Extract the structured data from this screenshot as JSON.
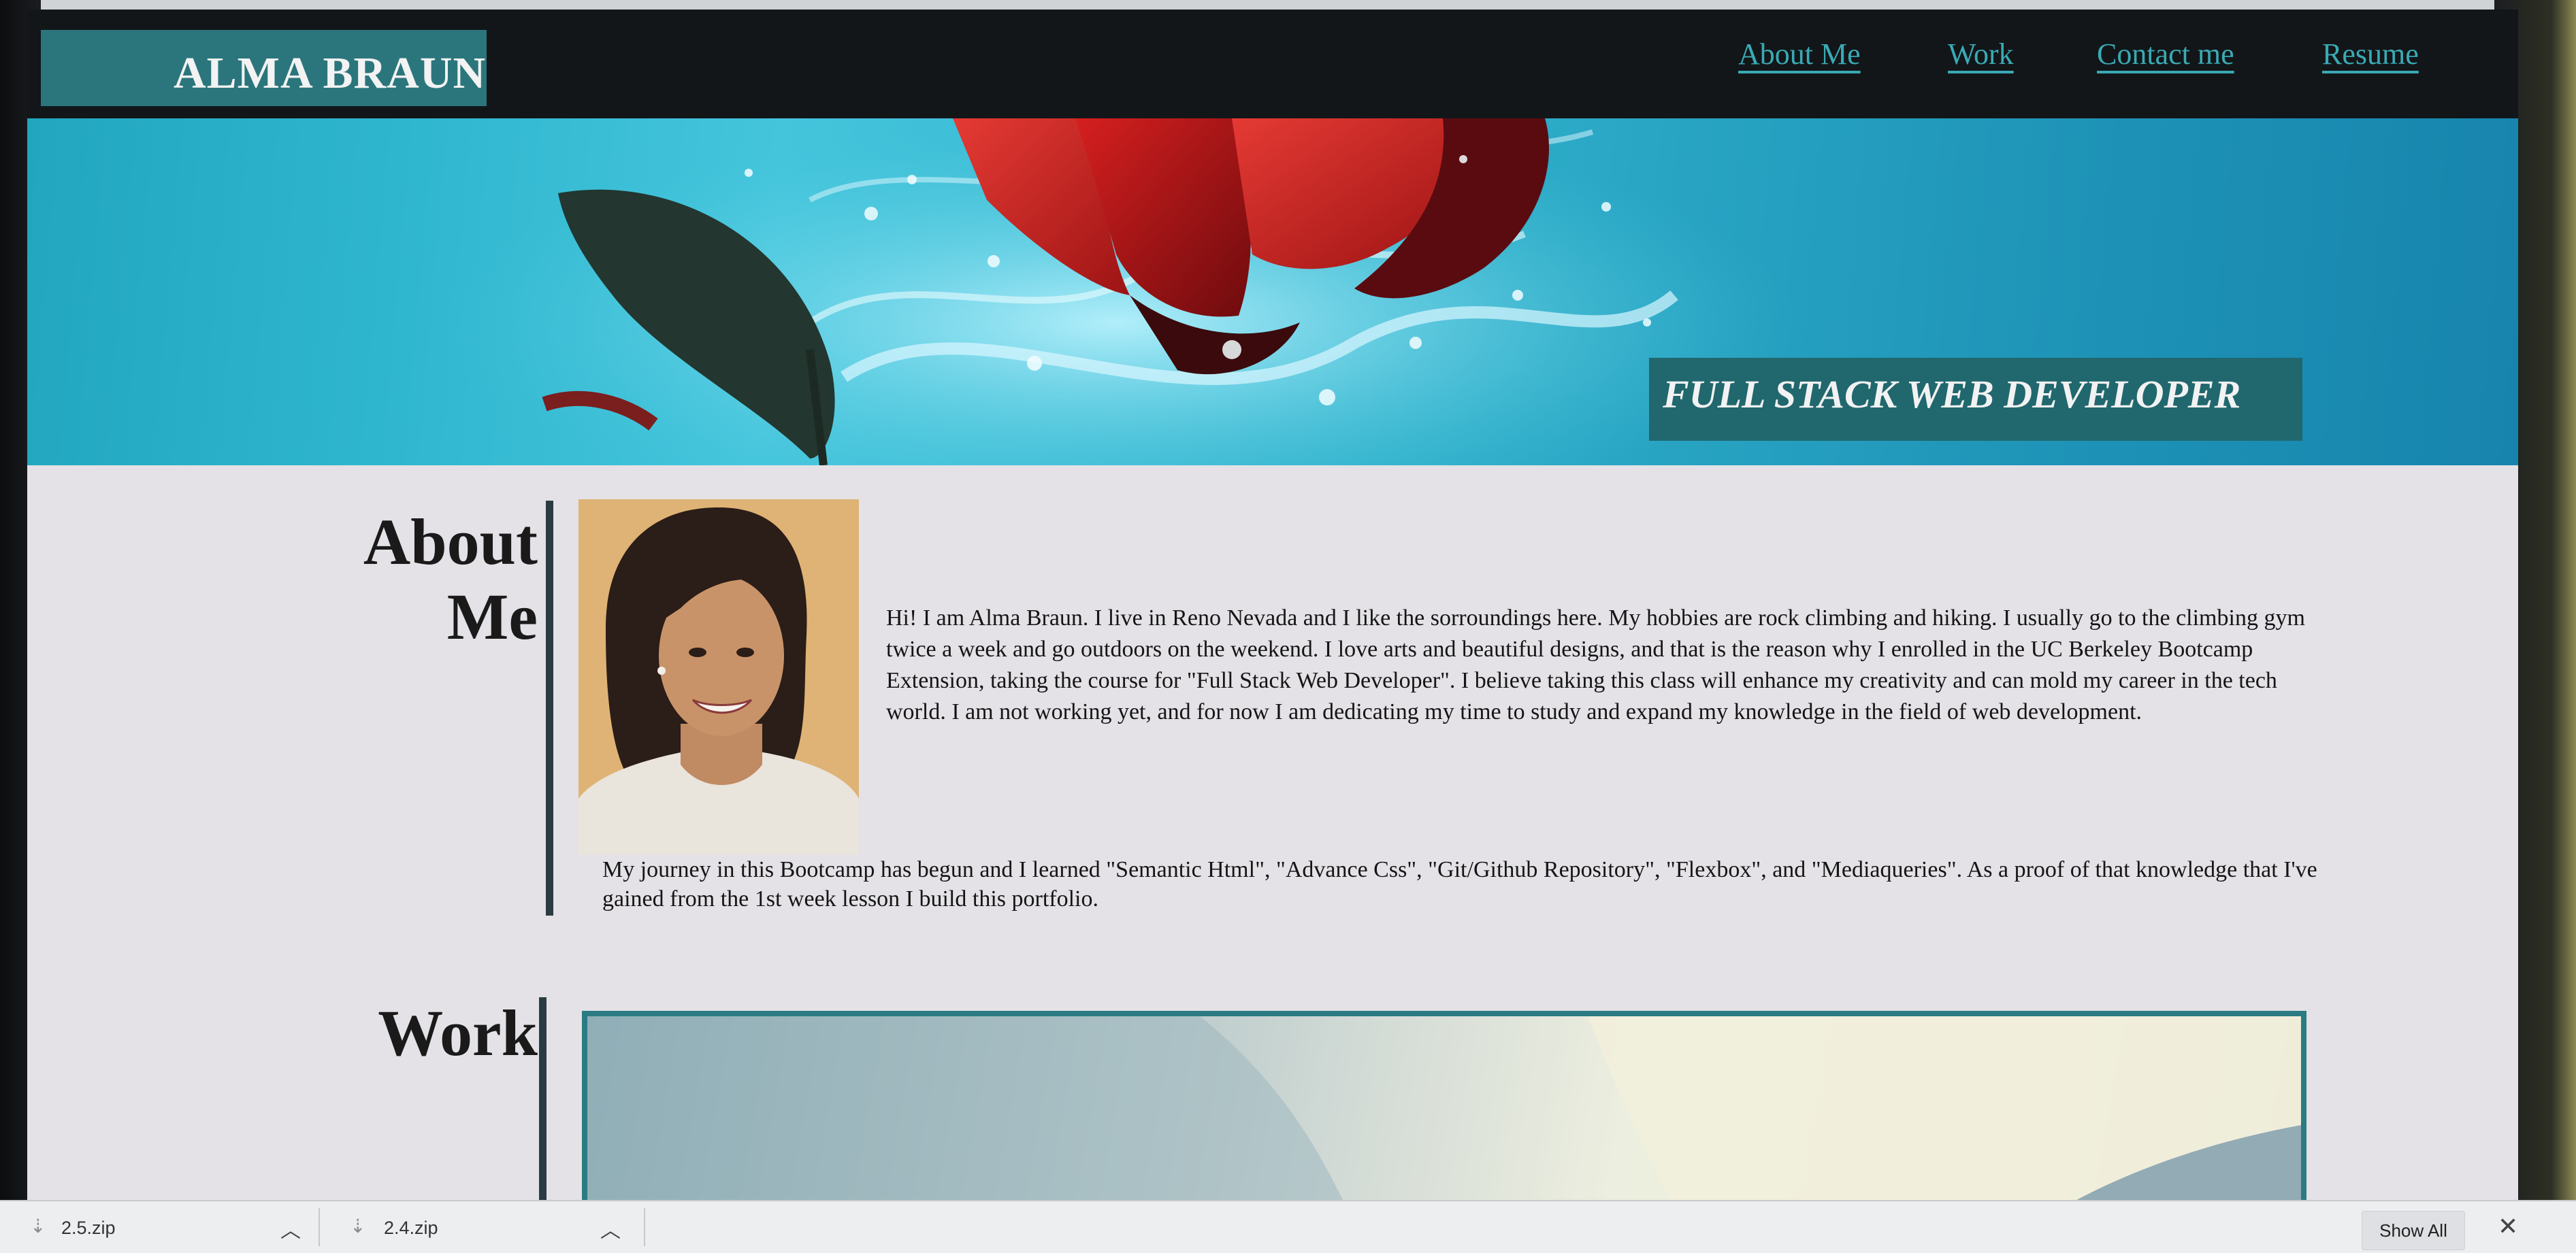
{
  "header": {
    "logo": "ALMA BRAUN",
    "nav": [
      {
        "label": "About Me"
      },
      {
        "label": "Work"
      },
      {
        "label": "Contact me"
      },
      {
        "label": "Resume"
      }
    ]
  },
  "hero": {
    "tagline": "FULL STACK WEB DEVELOPER"
  },
  "about": {
    "heading_line1": "About",
    "heading_line2": "Me",
    "bio_paragraph_1": "Hi! I am Alma Braun. I live in Reno Nevada and I like the sorroundings here. My hobbies are rock climbing and hiking. I usually go to the climbing gym twice a week and go outdoors on the weekend. I love arts and beautiful designs, and that is the reason why I enrolled in the UC Berkeley Bootcamp Extension, taking the course for \"Full Stack Web Developer\". I believe taking this class will enhance my creativity and can mold my career in the tech world. I am not working yet, and for now I am dedicating my time to study and expand my knowledge in the field of web development.",
    "bio_paragraph_2": "My journey in this Bootcamp has begun and I learned \"Semantic Html\", \"Advance Css\", \"Git/Github Repository\", \"Flexbox\", and \"Mediaqueries\". As a proof of that knowledge that I've gained from the 1st week lesson I build this portfolio."
  },
  "work": {
    "heading": "Work"
  },
  "download_bar": {
    "items": [
      {
        "name": "2.5.zip"
      },
      {
        "name": "2.4.zip"
      }
    ],
    "show_all_label": "Show All",
    "close_symbol": "✕"
  },
  "colors": {
    "header_bg": "#121619",
    "accent_teal": "#2b767c",
    "nav_link": "#3aaab4",
    "page_bg": "#e4e2e6"
  }
}
